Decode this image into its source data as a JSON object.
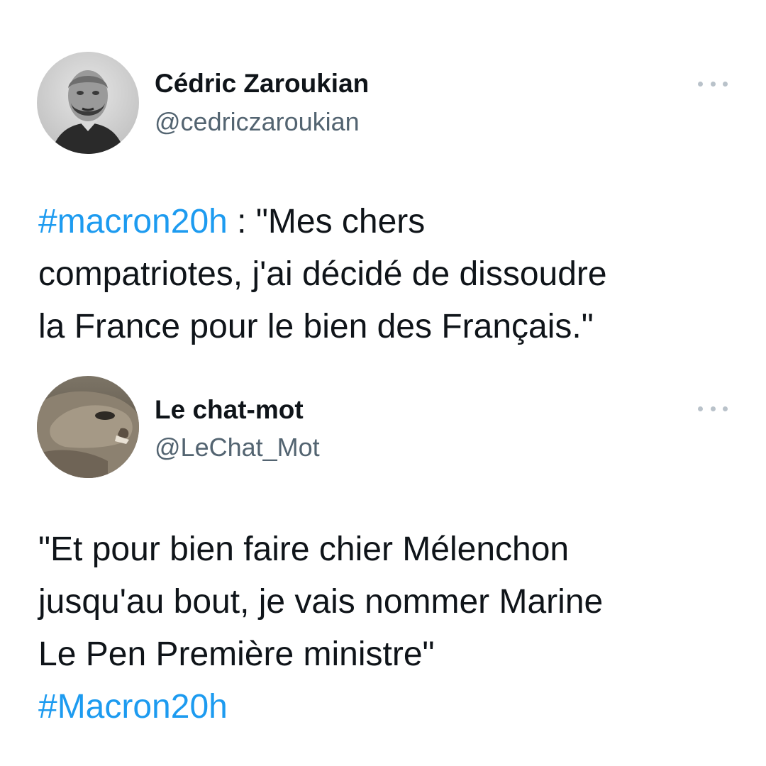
{
  "colors": {
    "text": "#0f1419",
    "handle": "#536471",
    "hashtag": "#1d9bf0",
    "more_dots": "#b9c2ca",
    "background": "#ffffff"
  },
  "tweets": [
    {
      "author": {
        "display_name": "Cédric Zaroukian",
        "handle": "@cedriczaroukian",
        "avatar_icon": "person-portrait-avatar"
      },
      "more_icon": "more-horizontal-icon",
      "text": {
        "hashtag": "#macron20h",
        "line1_rest": " : \"Mes chers",
        "line2": "compatriotes, j'ai décidé de dissoudre",
        "line3": "la France pour le bien des Français.\""
      }
    },
    {
      "author": {
        "display_name": "Le chat-mot",
        "handle": "@LeChat_Mot",
        "avatar_icon": "camel-avatar"
      },
      "more_icon": "more-horizontal-icon",
      "text": {
        "line1": "\"Et pour bien faire chier Mélenchon",
        "line2": "jusqu'au bout, je vais nommer Marine",
        "line3": "Le Pen Première ministre\"",
        "hashtag": "#Macron20h"
      }
    }
  ]
}
